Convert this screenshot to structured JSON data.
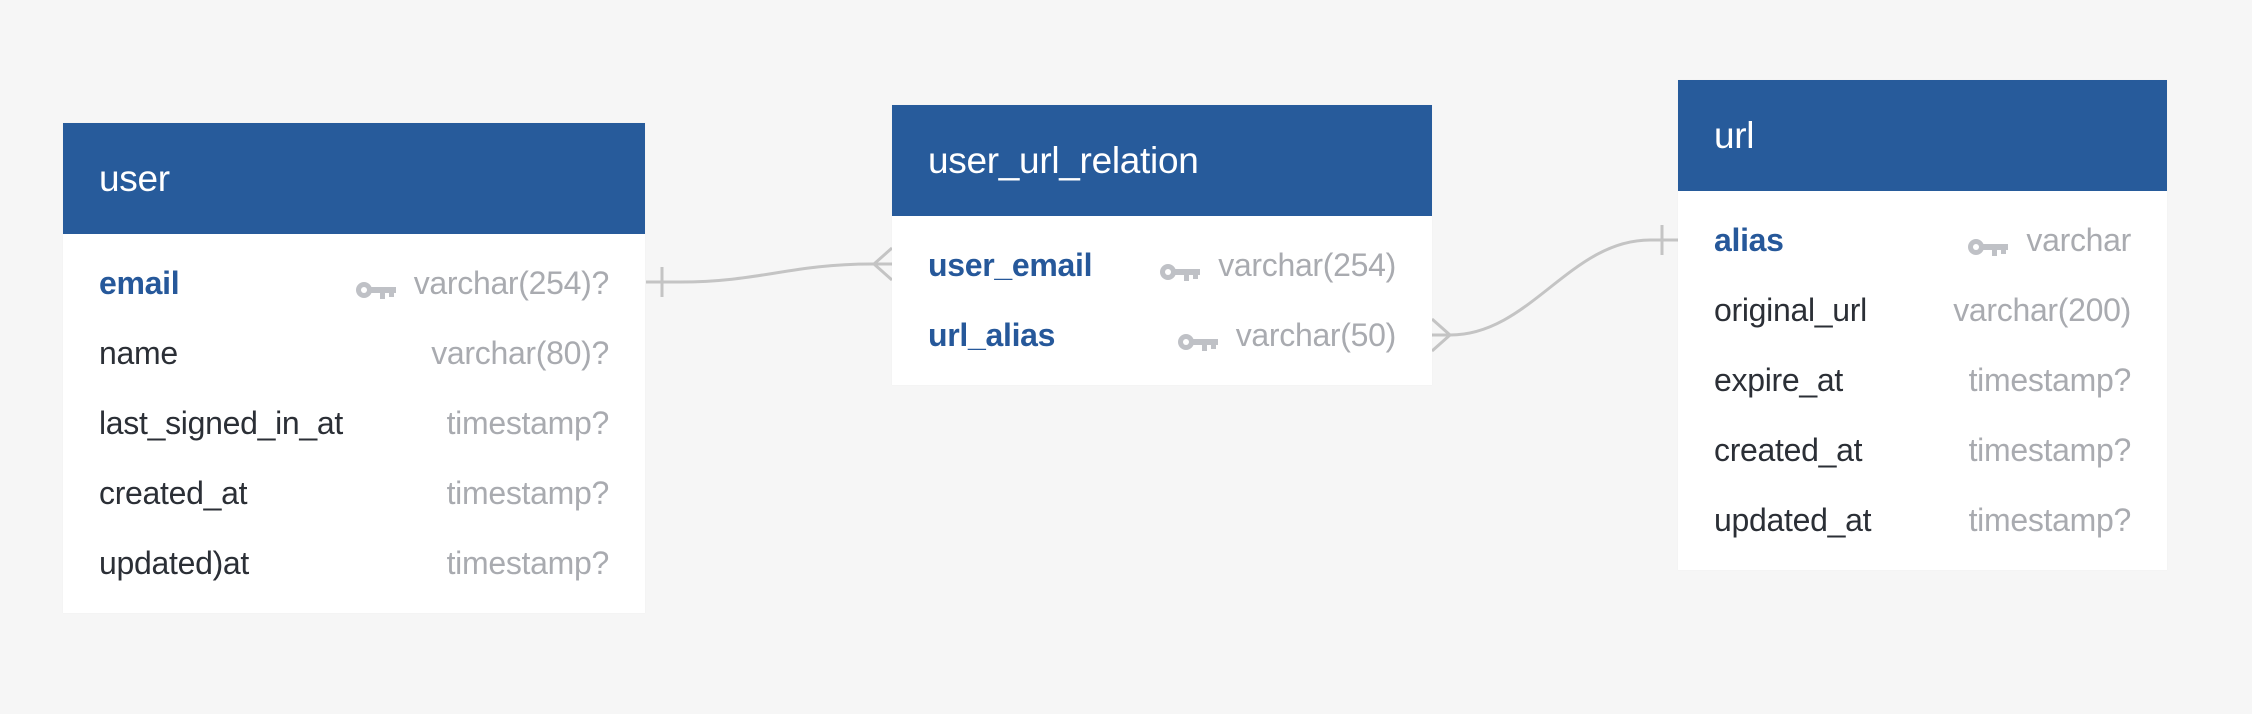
{
  "diagram": {
    "type": "entity-relationship",
    "colors": {
      "header": "#275b9b",
      "primary_key_text": "#26589a",
      "field_text": "#2b2f36",
      "type_text": "#a9abb0",
      "connector": "#c4c4c4",
      "background": "#f6f6f6"
    }
  },
  "tables": [
    {
      "id": "user",
      "title": "user",
      "fields": [
        {
          "name": "email",
          "type": "varchar(254)?",
          "pk": true,
          "icon": "key-icon"
        },
        {
          "name": "name",
          "type": "varchar(80)?",
          "pk": false
        },
        {
          "name": "last_signed_in_at",
          "type": "timestamp?",
          "pk": false
        },
        {
          "name": "created_at",
          "type": "timestamp?",
          "pk": false
        },
        {
          "name": "updated)at",
          "type": "timestamp?",
          "pk": false
        }
      ]
    },
    {
      "id": "user_url_relation",
      "title": "user_url_relation",
      "fields": [
        {
          "name": "user_email",
          "type": "varchar(254)",
          "pk": true,
          "icon": "key-icon"
        },
        {
          "name": "url_alias",
          "type": "varchar(50)",
          "pk": true,
          "icon": "key-icon"
        }
      ]
    },
    {
      "id": "url",
      "title": "url",
      "fields": [
        {
          "name": "alias",
          "type": "varchar",
          "pk": true,
          "icon": "key-icon"
        },
        {
          "name": "original_url",
          "type": "varchar(200)",
          "pk": false
        },
        {
          "name": "expire_at",
          "type": "timestamp?",
          "pk": false
        },
        {
          "name": "created_at",
          "type": "timestamp?",
          "pk": false
        },
        {
          "name": "updated_at",
          "type": "timestamp?",
          "pk": false
        }
      ]
    }
  ],
  "relations": [
    {
      "from": "user.email",
      "from_cardinality": "one",
      "to": "user_url_relation.user_email",
      "to_cardinality": "many"
    },
    {
      "from": "user_url_relation.url_alias",
      "from_cardinality": "many",
      "to": "url.alias",
      "to_cardinality": "one"
    }
  ]
}
